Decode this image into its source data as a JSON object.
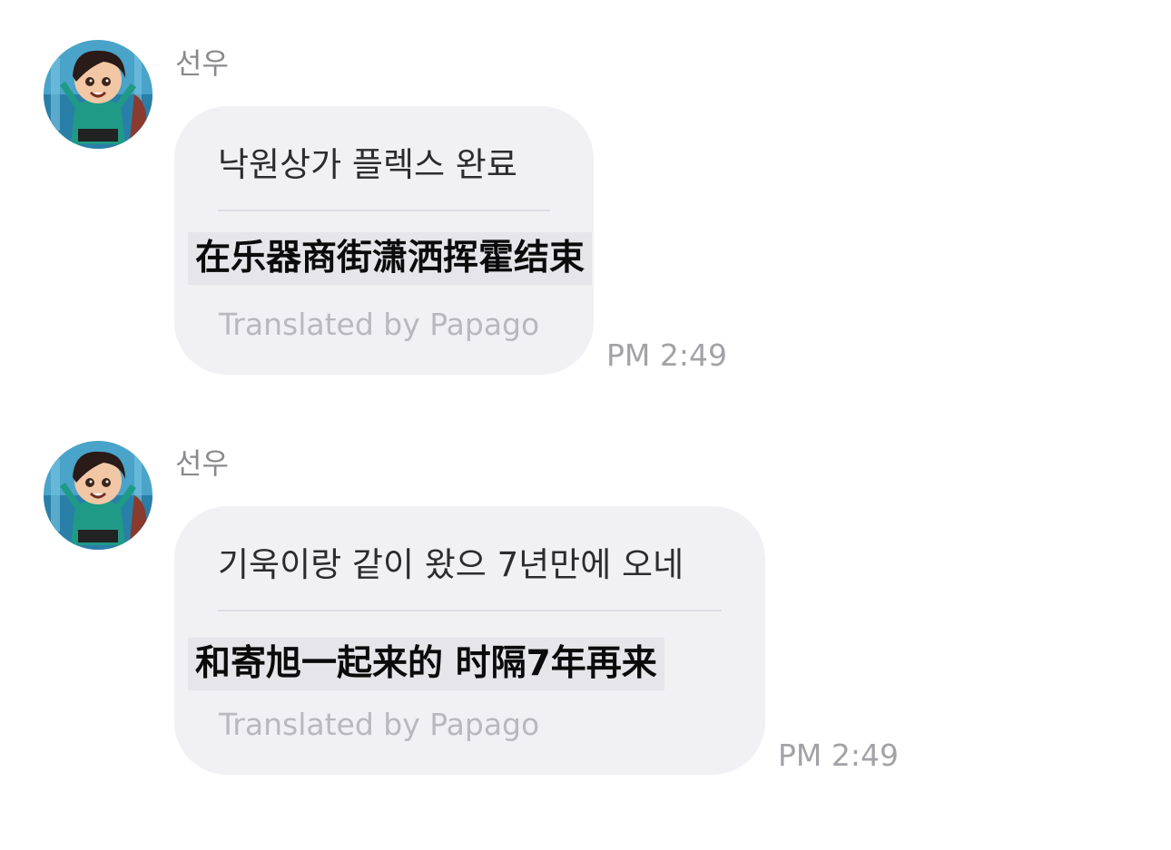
{
  "messages": [
    {
      "sender": "선우",
      "original": "낙원상가 플렉스 완료",
      "translated": "在乐器商街潇洒挥霍结束",
      "credit": "Translated by Papago",
      "time": "PM 2:49"
    },
    {
      "sender": "선우",
      "original": "기욱이랑 같이 왔으 7년만에 오네",
      "translated": "和寄旭一起来的 时隔7年再来",
      "credit": "Translated by Papago",
      "time": "PM 2:49"
    }
  ],
  "avatar": {
    "icon": "avatar-character-icon"
  }
}
